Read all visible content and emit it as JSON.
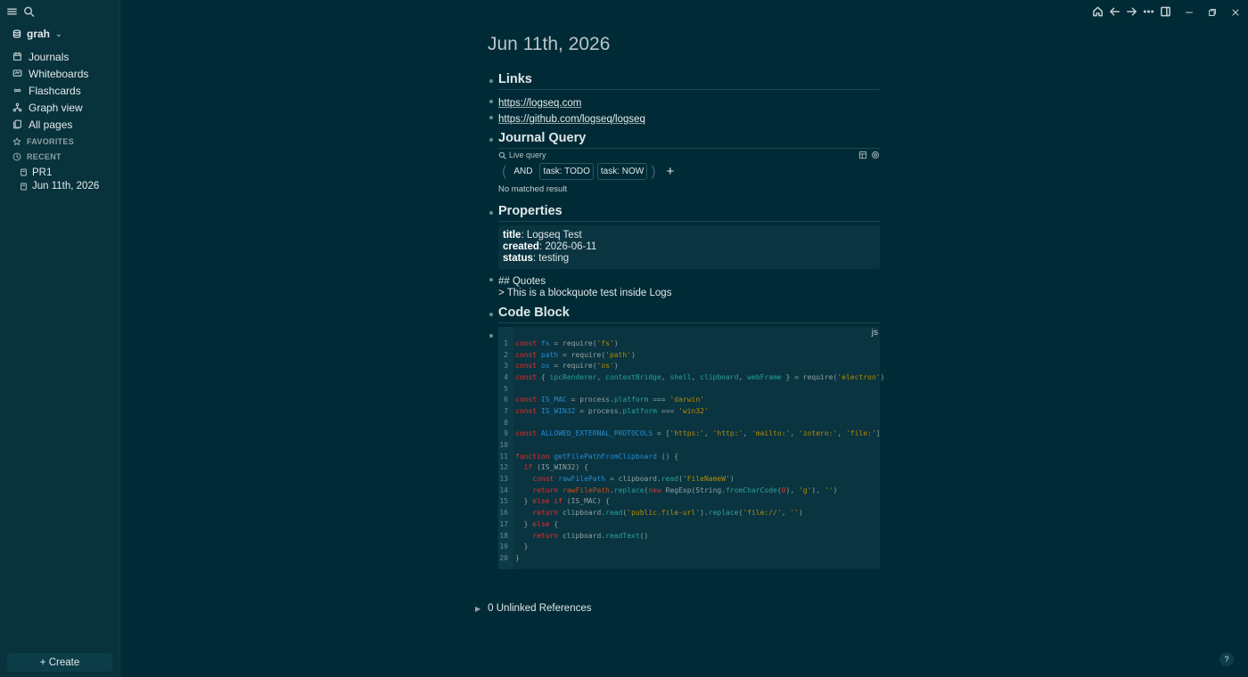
{
  "sidebar": {
    "graph_name": "grah",
    "nav": [
      {
        "label": "Journals",
        "icon": "calendar-icon"
      },
      {
        "label": "Whiteboards",
        "icon": "whiteboard-icon"
      },
      {
        "label": "Flashcards",
        "icon": "infinity-icon"
      },
      {
        "label": "Graph view",
        "icon": "graph-icon"
      },
      {
        "label": "All pages",
        "icon": "pages-icon"
      }
    ],
    "favorites_label": "FAVORITES",
    "recent_label": "RECENT",
    "recent": [
      "PR1",
      "Jun 11th, 2026"
    ],
    "create_label": "+ Create"
  },
  "page": {
    "title": "Jun 11th, 2026",
    "links_heading": "Links",
    "links": [
      "https://logseq.com",
      "https://github.com/logseq/logseq"
    ],
    "query_heading": "Journal Query",
    "query": {
      "label": "Live query",
      "op": "AND",
      "chips": [
        "task: TODO",
        "task: NOW"
      ],
      "add": "+",
      "empty": "No matched result"
    },
    "props_heading": "Properties",
    "props": [
      {
        "key": "title",
        "value": "Logseq Test"
      },
      {
        "key": "created",
        "value": "2026-06-11"
      },
      {
        "key": "status",
        "value": "testing"
      }
    ],
    "quote_lines": [
      "## Quotes",
      "> This is a blockquote test inside Logs"
    ],
    "code_heading": "Code Block",
    "code_lang": "js",
    "unlinked": "0 Unlinked References"
  },
  "help": "?",
  "colors": {
    "bg": "#002b36",
    "sidebar": "#08323c"
  }
}
